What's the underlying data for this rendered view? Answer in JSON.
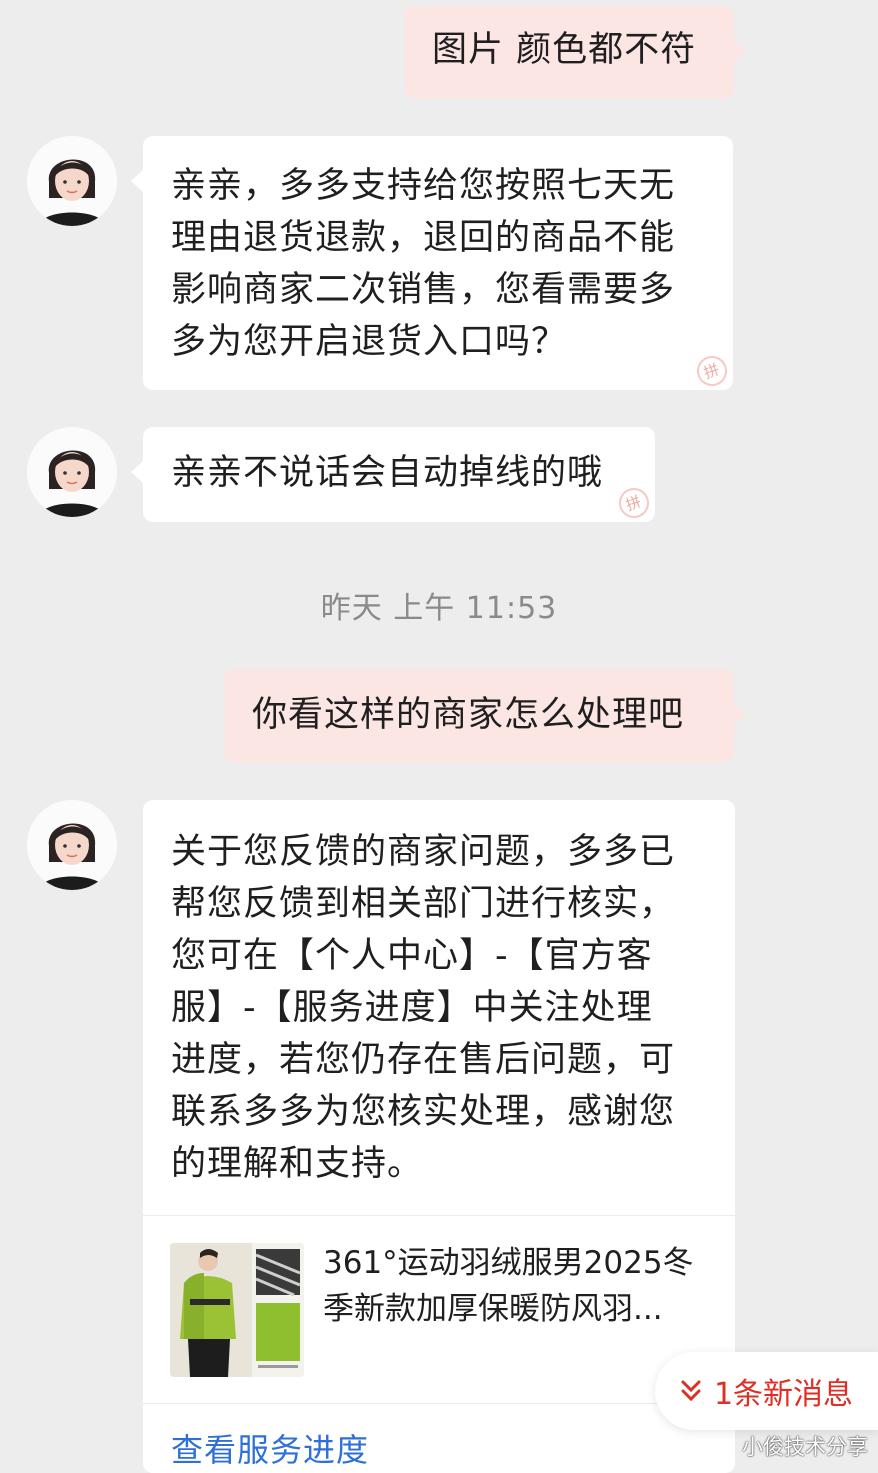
{
  "messages": {
    "m1_user": "图片 颜色都不符",
    "m2_bot_lines": [
      "亲亲，多多支持给您按照七天无",
      "理由退货退款，退回的商品不能",
      "影响商家二次销售，您看需要多",
      "多为您开启退货入口吗？"
    ],
    "m3_bot": "亲亲不说话会自动掉线的哦",
    "timestamp": "昨天 上午 11:53",
    "m4_user": "你看这样的商家怎么处理吧",
    "m5_bot_lines": [
      "关于您反馈的商家问题，多多已",
      "帮您反馈到相关部门进行核实，",
      "您可在【个人中心】-【官方客",
      "服】-【服务进度】中关注处理",
      "进度，若您仍存在售后问题，可",
      "联系多多为您核实处理，感谢您",
      "的理解和支持。"
    ]
  },
  "product": {
    "title": "361°运动羽绒服男2025冬季新款加厚保暖防风羽..."
  },
  "service_link": "查看服务进度",
  "new_message_badge": "1条新消息",
  "watermark": "小俊技术分享",
  "colors": {
    "background": "#ededed",
    "user_bubble": "#fce6e4",
    "bot_bubble": "#ffffff",
    "accent_red": "#e02e24",
    "link_blue": "#2f6fd8"
  },
  "icons": {
    "avatar": "agent-avatar",
    "new_message_arrow": "double-chevron-down-icon"
  }
}
